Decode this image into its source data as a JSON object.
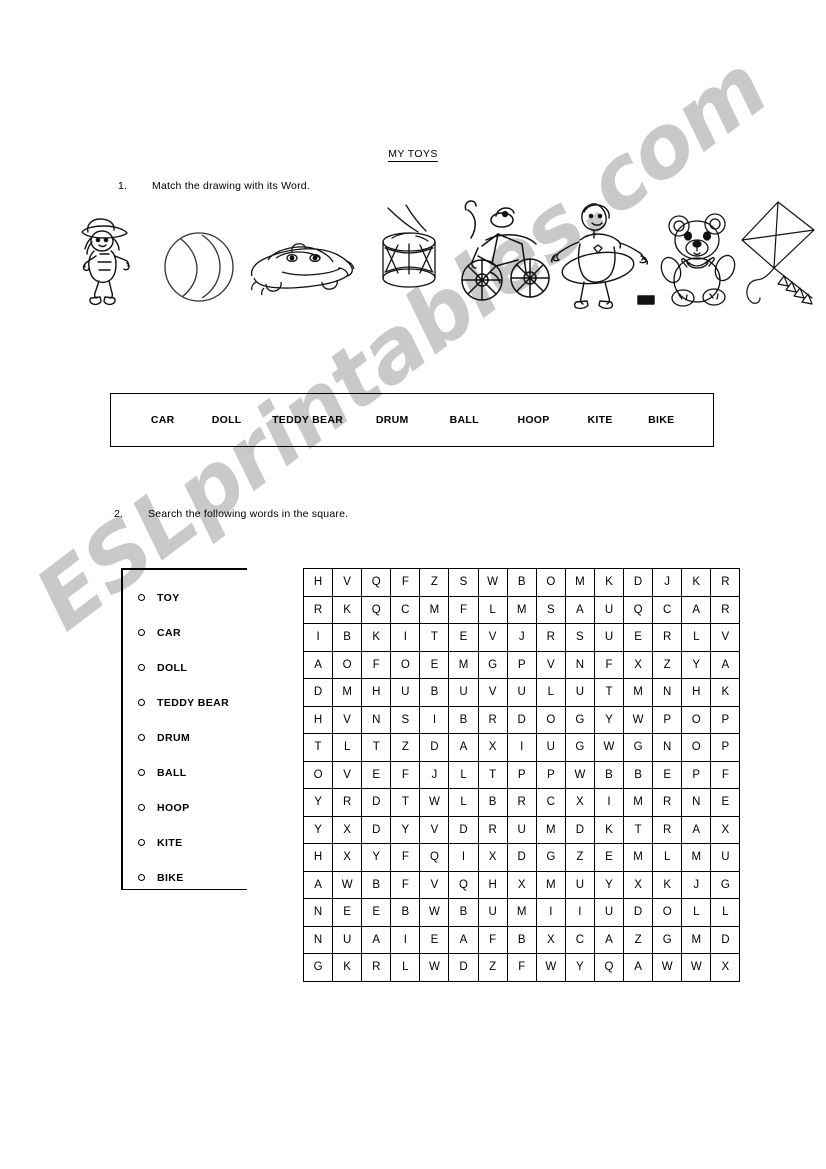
{
  "document": {
    "title": "MY TOYS"
  },
  "exercises": [
    {
      "number": "1.",
      "instruction": "Match the drawing with its Word."
    },
    {
      "number": "2.",
      "instruction": "Search the following words in the square."
    }
  ],
  "pictures": [
    {
      "name": "doll-drawing",
      "label": "doll"
    },
    {
      "name": "ball-drawing",
      "label": "ball"
    },
    {
      "name": "car-drawing",
      "label": "car"
    },
    {
      "name": "drum-drawing",
      "label": "drum"
    },
    {
      "name": "bike-drawing",
      "label": "bike"
    },
    {
      "name": "hoop-drawing",
      "label": "hoop"
    },
    {
      "name": "teddy-bear-drawing",
      "label": "teddy bear"
    },
    {
      "name": "kite-drawing",
      "label": "kite"
    }
  ],
  "word_bank": {
    "words": [
      "CAR",
      "DOLL",
      "TEDDY BEAR",
      "DRUM",
      "BALL",
      "HOOP",
      "KITE",
      "BIKE"
    ]
  },
  "word_list": {
    "words": [
      "TOY",
      "CAR",
      "DOLL",
      "TEDDY BEAR",
      "DRUM",
      "BALL",
      "HOOP",
      "KITE",
      "BIKE"
    ]
  },
  "word_search": {
    "rows": 14,
    "cols": 14,
    "grid": [
      [
        "H",
        "V",
        "Q",
        "F",
        "Z",
        "S",
        "W",
        "B",
        "O",
        "M",
        "K",
        "D",
        "J",
        "K",
        "R"
      ],
      [
        "R",
        "K",
        "Q",
        "C",
        "M",
        "F",
        "L",
        "M",
        "S",
        "A",
        "U",
        "Q",
        "C",
        "A",
        "R"
      ],
      [
        "I",
        "B",
        "K",
        "I",
        "T",
        "E",
        "V",
        "J",
        "R",
        "S",
        "U",
        "E",
        "R",
        "L",
        "V"
      ],
      [
        "A",
        "O",
        "F",
        "O",
        "E",
        "M",
        "G",
        "P",
        "V",
        "N",
        "F",
        "X",
        "Z",
        "Y",
        "A"
      ],
      [
        "D",
        "M",
        "H",
        "U",
        "B",
        "U",
        "V",
        "U",
        "L",
        "U",
        "T",
        "M",
        "N",
        "H",
        "K"
      ],
      [
        "H",
        "V",
        "N",
        "S",
        "I",
        "B",
        "R",
        "D",
        "O",
        "G",
        "Y",
        "W",
        "P",
        "O",
        "P"
      ],
      [
        "T",
        "L",
        "T",
        "Z",
        "D",
        "A",
        "X",
        "I",
        "U",
        "G",
        "W",
        "G",
        "N",
        "O",
        "P"
      ],
      [
        "O",
        "V",
        "E",
        "F",
        "J",
        "L",
        "T",
        "P",
        "P",
        "W",
        "B",
        "B",
        "E",
        "P",
        "F"
      ],
      [
        "Y",
        "R",
        "D",
        "T",
        "W",
        "L",
        "B",
        "R",
        "C",
        "X",
        "I",
        "M",
        "R",
        "N",
        "E"
      ],
      [
        "Y",
        "X",
        "D",
        "Y",
        "V",
        "D",
        "R",
        "U",
        "M",
        "D",
        "K",
        "T",
        "R",
        "A",
        "X"
      ],
      [
        "H",
        "X",
        "Y",
        "F",
        "Q",
        "I",
        "X",
        "D",
        "G",
        "Z",
        "E",
        "M",
        "L",
        "M",
        "U"
      ],
      [
        "A",
        "W",
        "B",
        "F",
        "V",
        "Q",
        "H",
        "X",
        "M",
        "U",
        "Y",
        "X",
        "K",
        "J",
        "G"
      ],
      [
        "N",
        "E",
        "E",
        "B",
        "W",
        "B",
        "U",
        "M",
        "I",
        "I",
        "U",
        "D",
        "O",
        "L",
        "L"
      ],
      [
        "N",
        "U",
        "A",
        "I",
        "E",
        "A",
        "F",
        "B",
        "X",
        "C",
        "A",
        "Z",
        "G",
        "M",
        "D"
      ],
      [
        "G",
        "K",
        "R",
        "L",
        "W",
        "D",
        "Z",
        "F",
        "W",
        "Y",
        "Q",
        "A",
        "W",
        "W",
        "X"
      ]
    ]
  },
  "watermark": {
    "text": "ESLprintables.com",
    "color": "#c9c9c9"
  }
}
